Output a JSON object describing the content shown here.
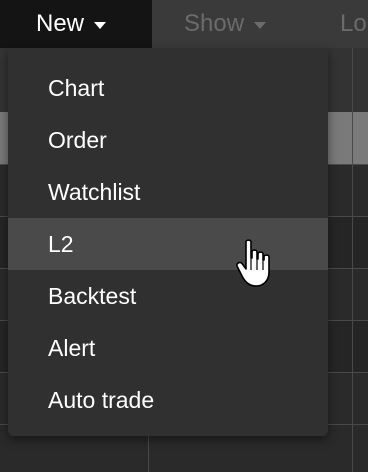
{
  "menubar": {
    "items": [
      {
        "label": "New"
      },
      {
        "label": "Show"
      },
      {
        "label": "Lo"
      }
    ]
  },
  "dropdown": {
    "items": [
      {
        "label": "Chart"
      },
      {
        "label": "Order"
      },
      {
        "label": "Watchlist"
      },
      {
        "label": "L2",
        "hovered": true
      },
      {
        "label": "Backtest"
      },
      {
        "label": "Alert"
      },
      {
        "label": "Auto trade"
      }
    ]
  },
  "cursor": {
    "icon": "hand-pointer-icon"
  },
  "colors": {
    "menubar_bg": "#3a3a3a",
    "active_menu_bg": "#141414",
    "dropdown_bg": "#303030",
    "hover_bg": "#4a4a4a",
    "text": "#ffffff",
    "muted_text": "#6b6b6b"
  }
}
